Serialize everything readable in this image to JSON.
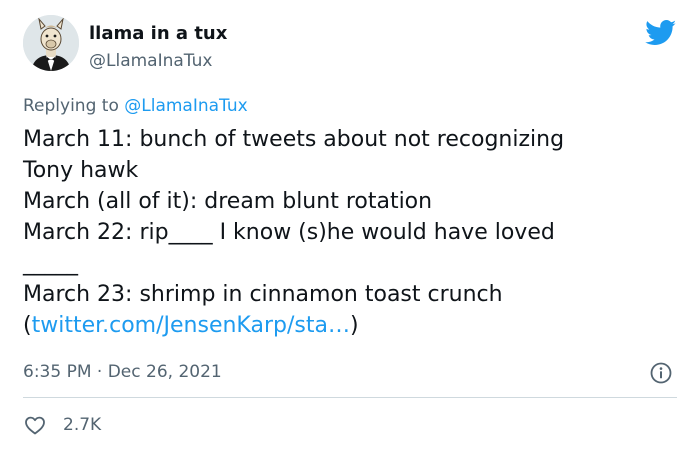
{
  "user": {
    "display_name": "llama in a tux",
    "handle": "@LlamaInaTux"
  },
  "reply": {
    "prefix": "Replying to ",
    "to_handle": "@LlamaInaTux"
  },
  "tweet": {
    "lines": [
      "March 11: bunch of tweets about not recognizing",
      "Tony hawk",
      "March (all of it): dream blunt rotation",
      "March 22: rip____ I know (s)he would have loved",
      "_____",
      "March 23: shrimp in cinnamon toast crunch"
    ],
    "link_open": "(",
    "link_text": "twitter.com/JensenKarp/sta…",
    "link_close": ")"
  },
  "meta": {
    "timestamp": "6:35 PM · Dec 26, 2021"
  },
  "actions": {
    "like_count": "2.7K"
  },
  "colors": {
    "accent": "#1d9bf0",
    "text": "#0f1419",
    "secondary": "#536471",
    "divider": "#cfd9de"
  },
  "icons": {
    "brand": "twitter-bird-icon",
    "info": "info-circle-icon",
    "like": "heart-outline-icon"
  }
}
